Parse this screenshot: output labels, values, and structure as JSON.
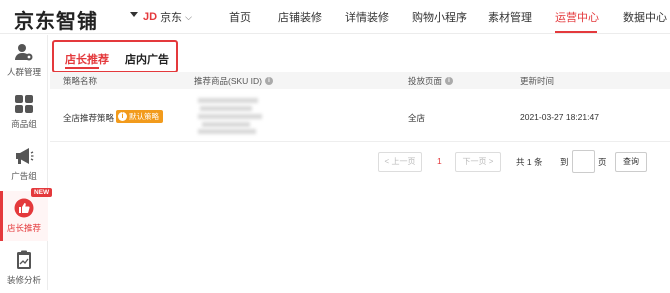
{
  "header": {
    "logo": "京东智铺",
    "store": {
      "brand": "JD",
      "name": "京东"
    },
    "nav": [
      {
        "label": "首页",
        "active": false
      },
      {
        "label": "店铺装修",
        "active": false
      },
      {
        "label": "详情装修",
        "active": false
      },
      {
        "label": "购物小程序",
        "active": false
      },
      {
        "label": "素材管理",
        "active": false
      },
      {
        "label": "运营中心",
        "active": true
      },
      {
        "label": "数据中心",
        "active": false
      }
    ]
  },
  "sidebar": {
    "items": [
      {
        "label": "人群管理",
        "icon": "user-gear-icon",
        "active": false
      },
      {
        "label": "商品组",
        "icon": "grid-icon",
        "active": false
      },
      {
        "label": "广告组",
        "icon": "megaphone-icon",
        "active": false
      },
      {
        "label": "店长推荐",
        "icon": "thumbs-up-icon",
        "active": true,
        "badge": "NEW"
      },
      {
        "label": "装修分析",
        "icon": "clipboard-chart-icon",
        "active": false
      }
    ]
  },
  "tabs": [
    {
      "label": "店长推荐",
      "active": true
    },
    {
      "label": "店内广告",
      "active": false
    }
  ],
  "table": {
    "columns": [
      "策略名称",
      "推荐商品(SKU ID)",
      "投放页面",
      "更新时间"
    ],
    "rows": [
      {
        "strategy_name": "全店推荐策略",
        "tag": "默认策略",
        "sku": "",
        "page": "全店",
        "updated": "2021-03-27 18:21:47"
      }
    ]
  },
  "pagination": {
    "prev": "< 上一页",
    "current": "1",
    "next": "下一页 >",
    "total": "共 1 条",
    "goto_prefix": "到",
    "goto_suffix": "页",
    "go_button": "查询"
  },
  "colors": {
    "accent": "#e4393c",
    "tag": "#f29b1c"
  }
}
